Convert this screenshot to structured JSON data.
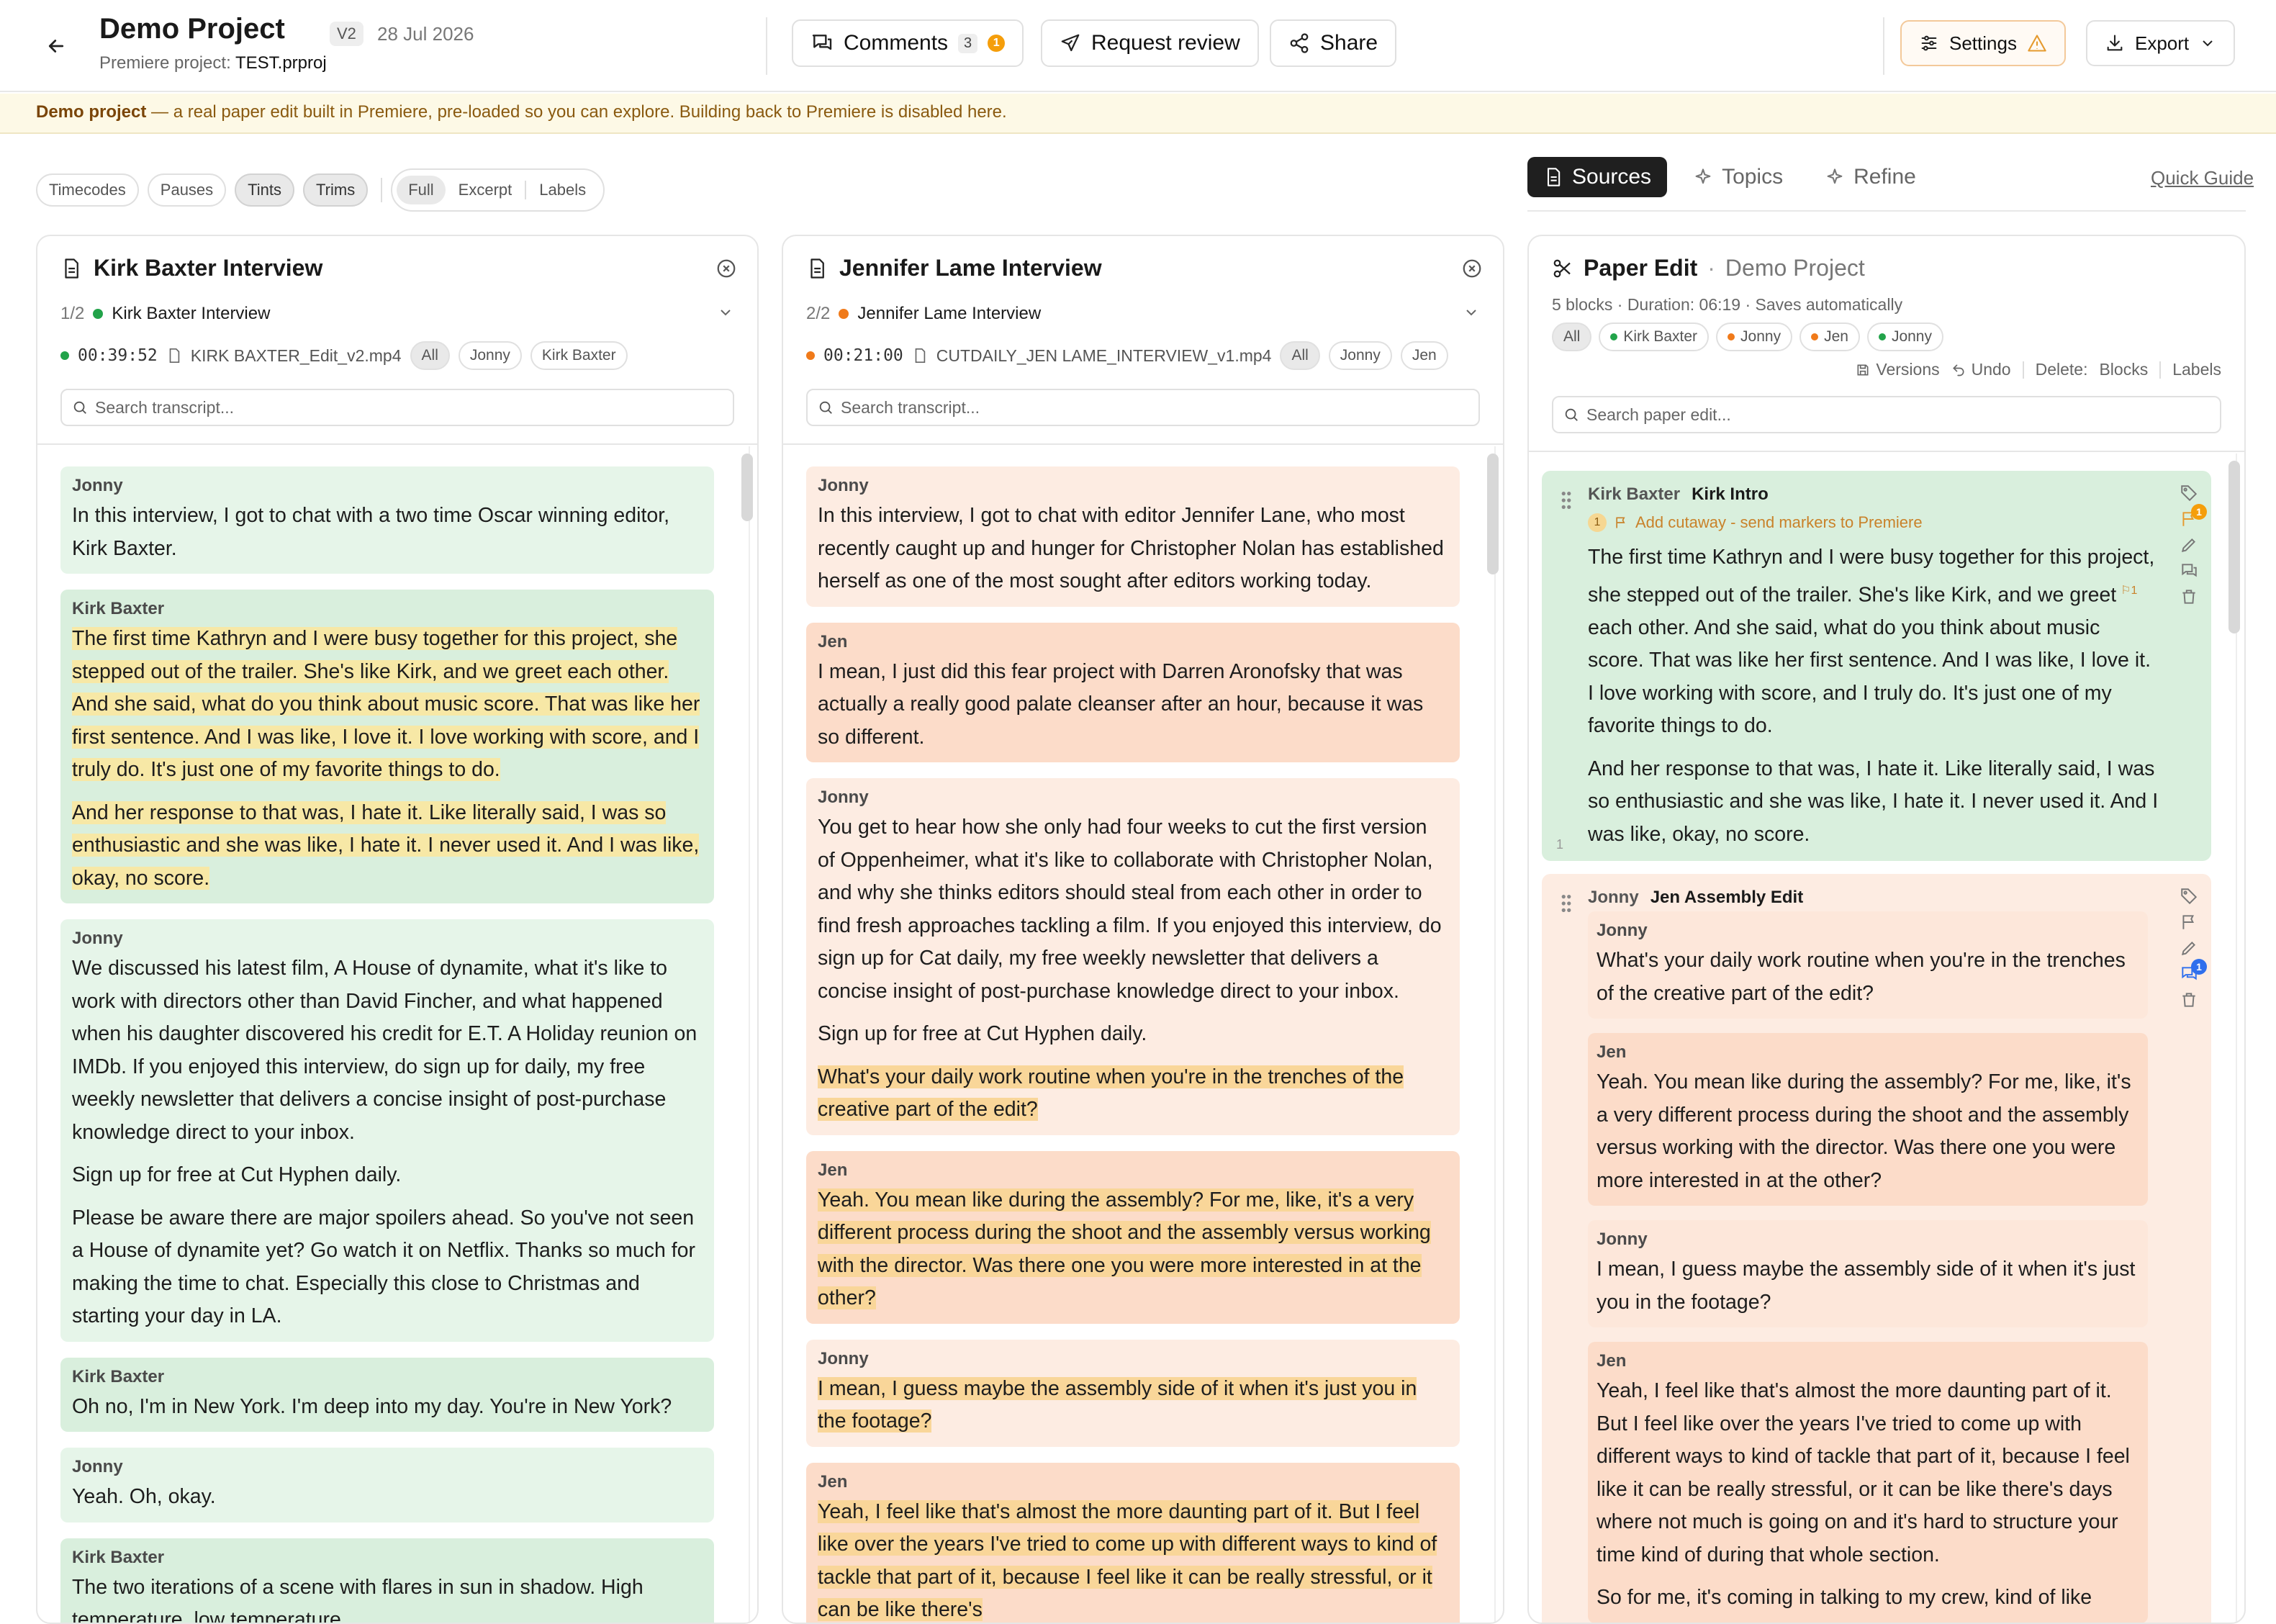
{
  "header": {
    "title": "Demo Project",
    "version": "V2",
    "date": "28 Jul 2026",
    "subtitle_prefix": "Premiere project:",
    "subtitle_file": "TEST.prproj",
    "comments_label": "Comments",
    "comments_count": "3",
    "comments_alert": "1",
    "request_review_label": "Request review",
    "share_label": "Share",
    "settings_label": "Settings",
    "export_label": "Export"
  },
  "banner": {
    "strong": "Demo project",
    "text": " — a real paper edit built in Premiere, pre-loaded so you can explore. Building back to Premiere is disabled here."
  },
  "filters": {
    "toggles": [
      {
        "label": "Timecodes",
        "active": false
      },
      {
        "label": "Pauses",
        "active": false
      },
      {
        "label": "Tints",
        "active": true
      },
      {
        "label": "Trims",
        "active": true
      }
    ],
    "view_modes": [
      {
        "label": "Full",
        "active": true
      },
      {
        "label": "Excerpt",
        "active": false
      },
      {
        "label": "Labels",
        "active": false
      }
    ]
  },
  "nav": {
    "tabs": [
      {
        "label": "Sources",
        "active": true
      },
      {
        "label": "Topics",
        "active": false
      },
      {
        "label": "Refine",
        "active": false
      }
    ],
    "quick_guide": "Quick Guide"
  },
  "colors": {
    "kirk_green": "#22a34a",
    "jen_orange": "#f07a1a",
    "green_tint": "#e6f5e9",
    "orange_tint": "#fdece2",
    "highlight": "#f7e8a6",
    "alert": "#f59e0b",
    "comment_badge": "#2f6fed"
  },
  "panel1": {
    "title": "Kirk Baxter Interview",
    "source_index": "1/2",
    "source_name": "Kirk Baxter Interview",
    "timecode": "00:39:52",
    "file": "KIRK BAXTER_Edit_v2.mp4",
    "speakers": [
      "All",
      "Jonny",
      "Kirk Baxter"
    ],
    "search_placeholder": "Search transcript...",
    "blocks": [
      {
        "speaker": "Jonny",
        "tint": "g",
        "paras": [
          {
            "text": "In this interview, I got to chat with a two time Oscar winning editor, Kirk Baxter.",
            "hl": false
          }
        ]
      },
      {
        "speaker": "Kirk Baxter",
        "tint": "g2",
        "paras": [
          {
            "text": "The first time Kathryn and I were busy together for this project, she stepped out of the trailer. She's like Kirk, and we greet each other. And she said, what do you think about music score. That was like her first sentence. And I was like, I love it. I love working with score, and I truly do. It's just one of my favorite things to do.",
            "hl": true
          },
          {
            "text": "And her response to that was, I hate it. Like literally said, I was so enthusiastic and she was like, I hate it. I never used it. And I was like, okay, no score.",
            "hl": true
          }
        ]
      },
      {
        "speaker": "Jonny",
        "tint": "g",
        "paras": [
          {
            "text": "We discussed his latest film, A House of dynamite, what it's like to work with directors other than David Fincher, and what happened when his daughter discovered his credit for E.T. A Holiday reunion on IMDb. If you enjoyed this interview, do sign up for daily, my free weekly newsletter that delivers a concise insight of post-purchase knowledge direct to your inbox.",
            "hl": false
          },
          {
            "text": "Sign up for free at Cut Hyphen daily.",
            "hl": false
          },
          {
            "text": "Please be aware there are major spoilers ahead. So you've not seen a House of dynamite yet? Go watch it on Netflix. Thanks so much for making the time to chat. Especially this close to Christmas and starting your day in LA.",
            "hl": false
          }
        ]
      },
      {
        "speaker": "Kirk Baxter",
        "tint": "g2",
        "paras": [
          {
            "text": "Oh no, I'm in New York. I'm deep into my day. You're in New York?",
            "hl": false
          }
        ]
      },
      {
        "speaker": "Jonny",
        "tint": "g",
        "paras": [
          {
            "text": "Yeah. Oh, okay.",
            "hl": false
          }
        ]
      },
      {
        "speaker": "Kirk Baxter",
        "tint": "g2",
        "paras": [
          {
            "text": "The two iterations of a scene with flares in sun in shadow. High temperature, low temperature.",
            "hl": false
          }
        ]
      }
    ]
  },
  "panel2": {
    "title": "Jennifer Lame Interview",
    "source_index": "2/2",
    "source_name": "Jennifer Lame Interview",
    "timecode": "00:21:00",
    "file": "CUTDAILY_JEN LAME_INTERVIEW_v1.mp4",
    "speakers": [
      "All",
      "Jonny",
      "Jen"
    ],
    "search_placeholder": "Search transcript...",
    "blocks": [
      {
        "speaker": "Jonny",
        "tint": "o",
        "paras": [
          {
            "text": "In this interview, I got to chat with editor Jennifer Lane, who most recently caught up and hunger for Christopher Nolan has established herself as one of the most sought after editors working today.",
            "hl": false
          }
        ]
      },
      {
        "speaker": "Jen",
        "tint": "o2",
        "paras": [
          {
            "text": "I mean, I just did this fear project with Darren Aronofsky that was actually a really good palate cleanser after an hour, because it was so different.",
            "hl": false
          }
        ]
      },
      {
        "speaker": "Jonny",
        "tint": "o",
        "paras": [
          {
            "text": "You get to hear how she only had four weeks to cut the first version of Oppenheimer, what it's like to collaborate with Christopher Nolan, and why she thinks editors should steal from each other in order to find fresh approaches tackling a film. If you enjoyed this interview, do sign up for Cat daily, my free weekly newsletter that delivers a concise insight of post-purchase knowledge direct to your inbox.",
            "hl": false
          },
          {
            "text": "Sign up for free at Cut Hyphen daily.",
            "hl": false
          },
          {
            "text": "What's your daily work routine when you're in the trenches of the creative part of the edit?",
            "hl": true
          }
        ]
      },
      {
        "speaker": "Jen",
        "tint": "o2",
        "paras": [
          {
            "text": "Yeah. You mean like during the assembly? For me, like, it's a very different process during the shoot and the assembly versus working with the director. Was there one you were more interested in at the other?",
            "hl": true
          }
        ]
      },
      {
        "speaker": "Jonny",
        "tint": "o",
        "paras": [
          {
            "text": "I mean, I guess maybe the assembly side of it when it's just you in the footage?",
            "hl": true
          }
        ]
      },
      {
        "speaker": "Jen",
        "tint": "o2",
        "paras": [
          {
            "text": "Yeah, I feel like that's almost the more daunting part of it. But I feel like over the years I've tried to come up with different ways to kind of tackle that part of it, because I feel like it can be really stressful, or it can be like there's",
            "hl": true
          }
        ]
      }
    ]
  },
  "paper_edit": {
    "title": "Paper Edit",
    "separator": "·",
    "project": "Demo Project",
    "stats": "5 blocks · Duration: 06:19 · Saves automatically",
    "speaker_filters": [
      {
        "label": "All",
        "color": ""
      },
      {
        "label": "Kirk Baxter",
        "color": "#22a34a"
      },
      {
        "label": "Jonny",
        "color": "#f07a1a"
      },
      {
        "label": "Jen",
        "color": "#f07a1a"
      },
      {
        "label": "Jonny",
        "color": "#22a34a"
      }
    ],
    "versions_label": "Versions",
    "undo_label": "Undo",
    "delete_label": "Delete:",
    "delete_blocks": "Blocks",
    "delete_labels": "Labels",
    "search_placeholder": "Search paper edit...",
    "block1": {
      "speaker": "Kirk Baxter",
      "title": "Kirk Intro",
      "note_num": "1",
      "note": "Add cutaway - send markers to Premiere",
      "flag_badge": "1",
      "para1_a": "The first time Kathryn and I were busy together for this project, she stepped out of the trailer. She's like Kirk, and we greet",
      "para1_mark": "1",
      "para1_b": "each other. And she said, what do you think about music score. That was like her first sentence. And I was like, I love it. I love working with score, and I truly do. It's just one of my favorite things to do.",
      "para2": "And her response to that was, I hate it. Like literally said, I was so enthusiastic and she was like, I hate it. I never used it. And I was like, okay, no score.",
      "line_num": "1"
    },
    "block2": {
      "speaker": "Jonny",
      "title": "Jen Assembly Edit",
      "comment_badge": "1",
      "items": [
        {
          "speaker": "Jonny",
          "text": "What's your daily work routine when you're in the trenches of the creative part of the edit?"
        },
        {
          "speaker": "Jen",
          "text": "Yeah. You mean like during the assembly? For me, like, it's a very different process during the shoot and the assembly versus working with the director. Was there one you were more interested in at the other?"
        },
        {
          "speaker": "Jonny",
          "text": "I mean, I guess maybe the assembly side of it when it's just you in the footage?"
        },
        {
          "speaker": "Jen",
          "text": "Yeah, I feel like that's almost the more daunting part of it. But I feel like over the years I've tried to come up with different ways to kind of tackle that part of it, because I feel like it can be really stressful, or it can be like there's days where not much is going on and it's hard to structure your time kind of during that whole section.",
          "extra": "So for me, it's coming in talking to my crew, kind of like"
        }
      ]
    }
  }
}
